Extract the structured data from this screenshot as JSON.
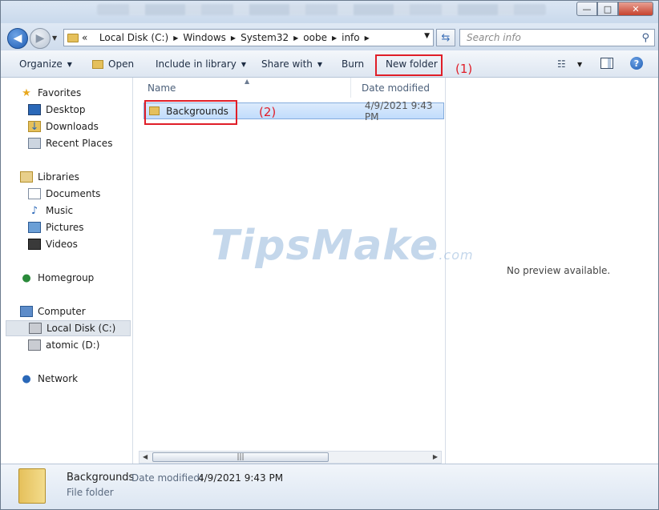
{
  "address": {
    "prefix": "«",
    "crumbs": [
      "Local Disk (C:)",
      "Windows",
      "System32",
      "oobe",
      "info"
    ],
    "search_placeholder": "Search info"
  },
  "toolbar": {
    "organize": "Organize",
    "open": "Open",
    "include_in_library": "Include in library",
    "share_with": "Share with",
    "burn": "Burn",
    "new_folder": "New folder"
  },
  "annotations": {
    "step1": "(1)",
    "step2": "(2)"
  },
  "nav": {
    "favorites": "Favorites",
    "desktop": "Desktop",
    "downloads": "Downloads",
    "recent_places": "Recent Places",
    "libraries": "Libraries",
    "documents": "Documents",
    "music": "Music",
    "pictures": "Pictures",
    "videos": "Videos",
    "homegroup": "Homegroup",
    "computer": "Computer",
    "local_disk": "Local Disk (C:)",
    "atomic": "atomic (D:)",
    "network": "Network"
  },
  "columns": {
    "name": "Name",
    "date_modified": "Date modified"
  },
  "files": [
    {
      "name": "Backgrounds",
      "date": "4/9/2021 9:43 PM"
    }
  ],
  "preview": {
    "text": "No preview available."
  },
  "watermark": {
    "main": "TipsMake",
    "suffix": ".com"
  },
  "details": {
    "name": "Backgrounds",
    "date_label": "Date modified:",
    "date": "4/9/2021 9:43 PM",
    "type": "File folder"
  },
  "colors": {
    "annotation_red": "#e01e28",
    "selection": "#c1dcfc"
  }
}
